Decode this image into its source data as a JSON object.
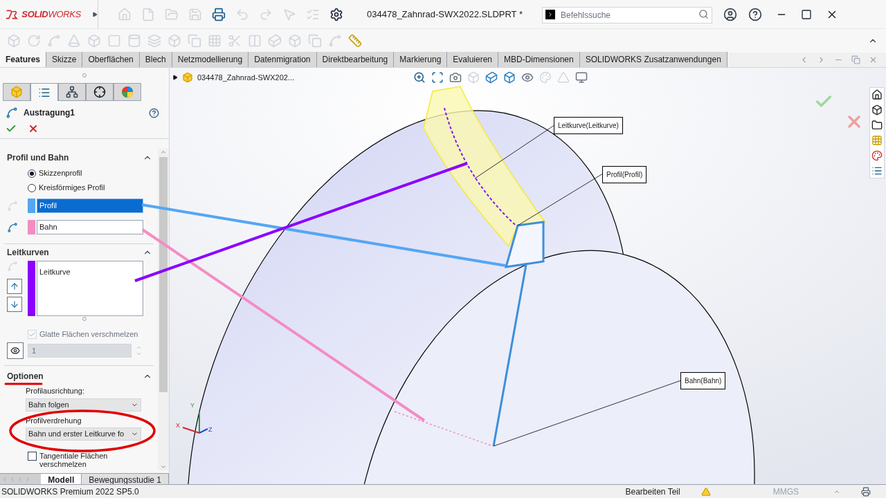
{
  "app": {
    "logo_a": "SOLID",
    "logo_b": "WORKS",
    "title": "034478_Zahnrad-SWX2022.SLDPRT *",
    "search": {
      "placeholder": "Befehlssuche"
    }
  },
  "tabs": [
    {
      "label": "Features",
      "selected": true
    },
    {
      "label": "Skizze",
      "selected": false
    },
    {
      "label": "Oberflächen",
      "selected": false
    },
    {
      "label": "Blech",
      "selected": false
    },
    {
      "label": "Netzmodellierung",
      "selected": false
    },
    {
      "label": "Datenmigration",
      "selected": false
    },
    {
      "label": "Direktbearbeitung",
      "selected": false
    },
    {
      "label": "Markierung",
      "selected": false
    },
    {
      "label": "Evaluieren",
      "selected": false
    },
    {
      "label": "MBD-Dimensionen",
      "selected": false
    },
    {
      "label": "SOLIDWORKS Zusatzanwendungen",
      "selected": false
    }
  ],
  "panel": {
    "tabs": [
      {
        "kind": "feature",
        "selected": false
      },
      {
        "kind": "property",
        "selected": true
      },
      {
        "kind": "config",
        "selected": false
      },
      {
        "kind": "dimxpert",
        "selected": false
      },
      {
        "kind": "display",
        "selected": false
      }
    ],
    "title": "Austragung1",
    "profil_und_bahn": {
      "title": "Profil und Bahn",
      "radios": [
        {
          "label": "Skizzenprofil",
          "selected": true
        },
        {
          "label": "Kreisförmiges Profil",
          "selected": false
        }
      ],
      "fields": [
        {
          "value": "Profil",
          "color": "#55a6f2",
          "selected": true
        },
        {
          "value": "Bahn",
          "color": "#f48cc4",
          "selected": false
        }
      ]
    },
    "leitkurven": {
      "title": "Leitkurven",
      "items": [
        {
          "label": "Leitkurve",
          "color": "#8b00ff"
        }
      ],
      "merge": {
        "label": "Glatte Flächen verschmelzen",
        "checked": true,
        "disabled": true
      },
      "count": "1"
    },
    "optionen": {
      "title": "Optionen",
      "orientation_label": "Profilausrichtung:",
      "orientation": "Bahn folgen",
      "twist_label": "Profilverdrehung",
      "twist": "Bahn und erster Leitkurve fo",
      "tangent": {
        "label": "Tangentiale Flächen verschmelzen",
        "checked": false
      }
    }
  },
  "bottom_tabs": [
    {
      "label": "Modell",
      "selected": true
    },
    {
      "label": "Bewegungsstudie 1",
      "selected": false
    }
  ],
  "tree": {
    "item": "034478_Zahnrad-SWX202..."
  },
  "callouts": [
    {
      "label": "Leitkurve(Leitkurve)"
    },
    {
      "label": "Profil(Profil)"
    },
    {
      "label": "Bahn(Bahn)"
    }
  ],
  "triad": {
    "x": "X",
    "y": "Y",
    "z": "Z"
  },
  "status_bar": {
    "product": "SOLIDWORKS Premium 2022 SP5.0",
    "mode": "Bearbeiten Teil",
    "units": "MMGS"
  }
}
